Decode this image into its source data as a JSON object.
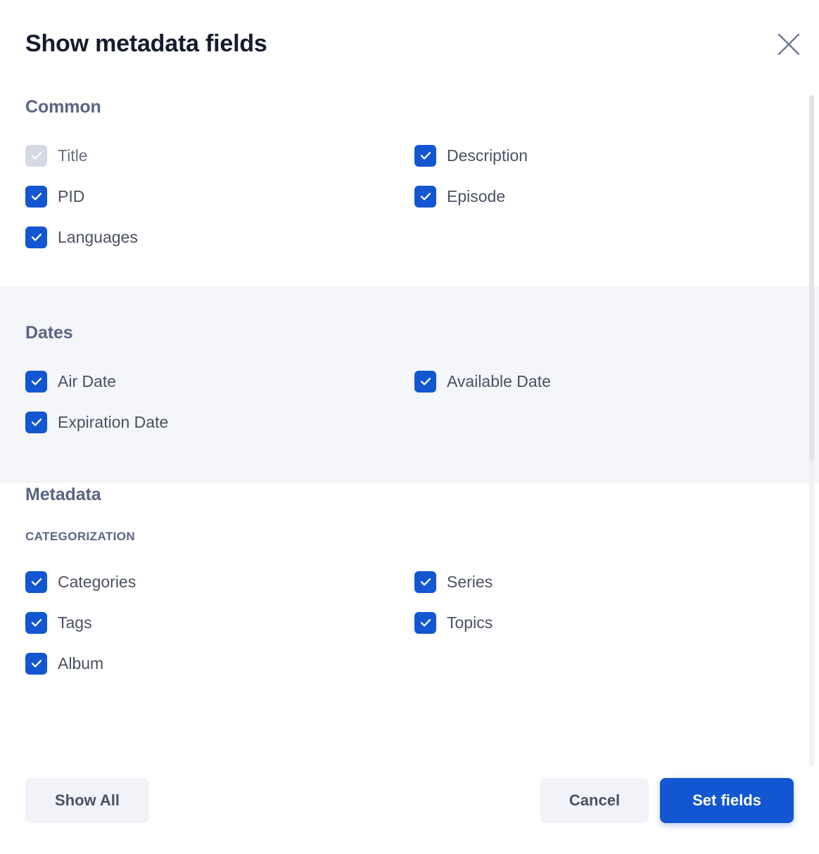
{
  "dialog": {
    "title": "Show metadata fields",
    "close_icon": "close-icon"
  },
  "sections": [
    {
      "id": "common",
      "title": "Common",
      "shaded": false,
      "fields": [
        {
          "label": "Title",
          "checked": true,
          "disabled": true,
          "column": "left"
        },
        {
          "label": "Description",
          "checked": true,
          "disabled": false,
          "column": "right"
        },
        {
          "label": "PID",
          "checked": true,
          "disabled": false,
          "column": "left"
        },
        {
          "label": "Episode",
          "checked": true,
          "disabled": false,
          "column": "right"
        },
        {
          "label": "Languages",
          "checked": true,
          "disabled": false,
          "column": "left"
        }
      ]
    },
    {
      "id": "dates",
      "title": "Dates",
      "shaded": true,
      "fields": [
        {
          "label": "Air Date",
          "checked": true,
          "disabled": false,
          "column": "left"
        },
        {
          "label": "Available Date",
          "checked": true,
          "disabled": false,
          "column": "right"
        },
        {
          "label": "Expiration Date",
          "checked": true,
          "disabled": false,
          "column": "left"
        }
      ]
    },
    {
      "id": "metadata",
      "title": "Metadata",
      "shaded": false,
      "subsection": "CATEGORIZATION",
      "fields": [
        {
          "label": "Categories",
          "checked": true,
          "disabled": false,
          "column": "left"
        },
        {
          "label": "Series",
          "checked": true,
          "disabled": false,
          "column": "right"
        },
        {
          "label": "Tags",
          "checked": true,
          "disabled": false,
          "column": "left"
        },
        {
          "label": "Topics",
          "checked": true,
          "disabled": false,
          "column": "right"
        },
        {
          "label": "Album",
          "checked": true,
          "disabled": false,
          "column": "left"
        }
      ]
    }
  ],
  "footer": {
    "show_all_label": "Show All",
    "cancel_label": "Cancel",
    "submit_label": "Set fields"
  },
  "colors": {
    "accent": "#1257d1",
    "heading": "#5a6485",
    "title": "#161c2d",
    "label": "#4b5161",
    "shaded_section": "#f5f6f9",
    "checkbox_disabled": "#d6dae3",
    "button_secondary": "#f1f3f8"
  }
}
